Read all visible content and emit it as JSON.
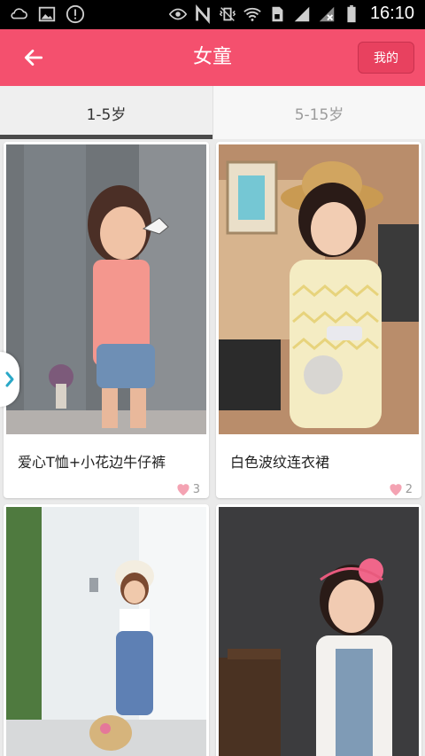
{
  "status_bar": {
    "time": "16:10",
    "icons": [
      "cloud-icon",
      "image-icon",
      "alert-icon",
      "eye-icon",
      "nfc-icon",
      "vibrate-off-icon",
      "wifi-icon",
      "sim-icon",
      "signal-icon",
      "signal-x-icon",
      "battery-icon"
    ]
  },
  "header": {
    "title": "女童",
    "back_icon": "back-arrow-icon",
    "mine_label": "我的",
    "color": "#f4506e"
  },
  "tabs": [
    {
      "label": "1-5岁",
      "active": true
    },
    {
      "label": "5-15岁",
      "active": false
    }
  ],
  "products": [
    {
      "name": "爱心T恤+小花边牛仔裤",
      "likes": "3"
    },
    {
      "name": "白色波纹连衣裙",
      "likes": "2"
    },
    {
      "name": "",
      "likes": ""
    },
    {
      "name": "",
      "likes": ""
    }
  ],
  "side_tab": {
    "icon": "chevron-right-icon",
    "color": "#2aa8c7"
  }
}
